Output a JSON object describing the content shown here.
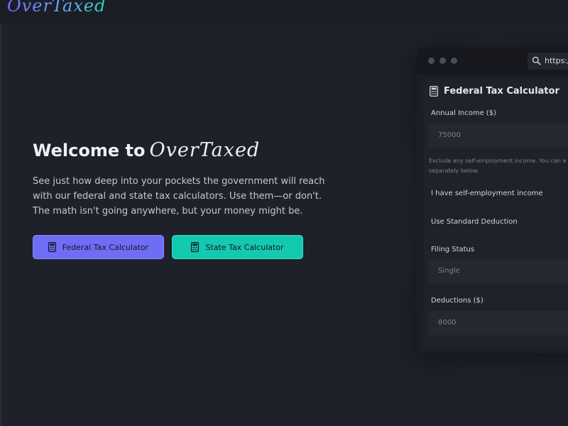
{
  "header": {
    "logo": "OverTaxed"
  },
  "hero": {
    "title": "Welcome to",
    "brand": "OverTaxed",
    "description": "See just how deep into your pockets the government will reach with our federal and state tax calculators. Use them—or don't. The math isn't going anywhere, but your money might be."
  },
  "buttons": {
    "federal": {
      "label": "Federal Tax Calculator",
      "icon": "calculator-icon",
      "color": "#6f6cf6"
    },
    "state": {
      "label": "State Tax Calculator",
      "icon": "calculator-icon",
      "color": "#13c9b0"
    }
  },
  "preview": {
    "url": "https:/",
    "title": "Federal Tax Calculator",
    "title_icon": "calculator-icon",
    "income_label": "Annual Income ($)",
    "income_value": "75000",
    "hint": "Exclude any self-employment income. You can e separately below.",
    "self_employment_label": "I have self-employment income",
    "standard_deduction_label": "Use Standard Deduction",
    "filing_status_label": "Filing Status",
    "filing_status_value": "Single",
    "deductions_label": "Deductions ($)",
    "deductions_value": "8000"
  },
  "colors": {
    "background": "#1e2129",
    "accent_purple": "#6f6cf6",
    "accent_teal": "#13c9b0"
  }
}
